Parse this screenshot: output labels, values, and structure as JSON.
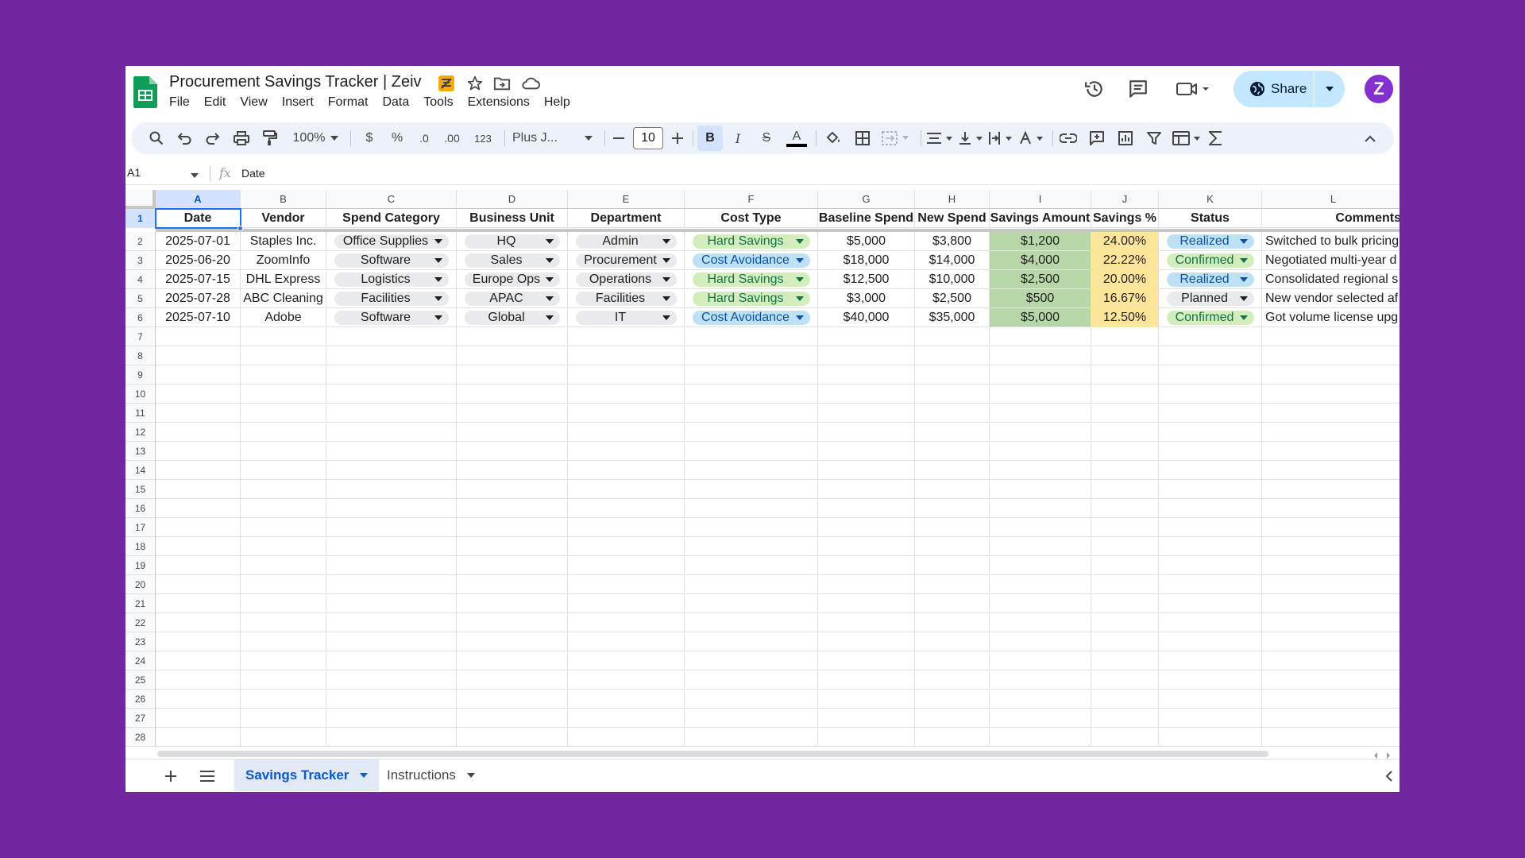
{
  "app": {
    "doc_title": "Procurement Savings Tracker | Zeiv",
    "menu": [
      "File",
      "Edit",
      "View",
      "Insert",
      "Format",
      "Data",
      "Tools",
      "Extensions",
      "Help"
    ],
    "share_label": "Share",
    "avatar_letter": "Z"
  },
  "toolbar": {
    "zoom": "100%",
    "currency": "$",
    "percent": "%",
    "dec_decrease": ".0",
    "dec_increase": ".00",
    "number_format": "123",
    "font": "Plus J...",
    "font_size": "10",
    "bold": "B",
    "italic": "I",
    "strikethrough": "S",
    "text_color": "A"
  },
  "formula_bar": {
    "cell_ref": "A1",
    "value": "Date"
  },
  "sheet": {
    "columns": [
      "A",
      "B",
      "C",
      "D",
      "E",
      "F",
      "G",
      "H",
      "I",
      "J",
      "K",
      "L"
    ],
    "headers": [
      "Date",
      "Vendor",
      "Spend Category",
      "Business Unit",
      "Department",
      "Cost Type",
      "Baseline Spend",
      "New Spend",
      "Savings Amount",
      "Savings %",
      "Status",
      "Comments"
    ],
    "rows": [
      [
        "2025-07-01",
        "Staples Inc.",
        "Office Supplies",
        "HQ",
        "Admin",
        "Hard Savings",
        "$5,000",
        "$3,800",
        "$1,200",
        "24.00%",
        "Realized",
        "Switched to bulk pricing"
      ],
      [
        "2025-06-20",
        "ZoomInfo",
        "Software",
        "Sales",
        "Procurement",
        "Cost Avoidance",
        "$18,000",
        "$14,000",
        "$4,000",
        "22.22%",
        "Confirmed",
        "Negotiated multi-year d"
      ],
      [
        "2025-07-15",
        "DHL Express",
        "Logistics",
        "Europe Ops",
        "Operations",
        "Hard Savings",
        "$12,500",
        "$10,000",
        "$2,500",
        "20.00%",
        "Realized",
        "Consolidated regional s"
      ],
      [
        "2025-07-28",
        "ABC Cleaning",
        "Facilities",
        "APAC",
        "Facilities",
        "Hard Savings",
        "$3,000",
        "$2,500",
        "$500",
        "16.67%",
        "Planned",
        "New vendor selected af"
      ],
      [
        "2025-07-10",
        "Adobe",
        "Software",
        "Global",
        "IT",
        "Cost Avoidance",
        "$40,000",
        "$35,000",
        "$5,000",
        "12.50%",
        "Confirmed",
        "Got volume license upg"
      ]
    ],
    "row_numbers": [
      "1",
      "2",
      "3",
      "4",
      "5",
      "6",
      "7",
      "8",
      "9",
      "10",
      "11",
      "12",
      "13",
      "14",
      "15",
      "16",
      "17",
      "18",
      "19",
      "20",
      "21",
      "22",
      "23",
      "24",
      "25",
      "26",
      "27",
      "28"
    ]
  },
  "tabs": [
    {
      "label": "Savings Tracker",
      "active": true
    },
    {
      "label": "Instructions",
      "active": false
    }
  ],
  "colors": {
    "background": "#7027A0",
    "savings_fill": "#b7d7a8",
    "percent_fill": "#ffe599",
    "chip_green": "#d4edbc",
    "chip_blue": "#bfe1f6",
    "chip_gray": "#e8eaed",
    "share_button": "#c2e7ff"
  }
}
